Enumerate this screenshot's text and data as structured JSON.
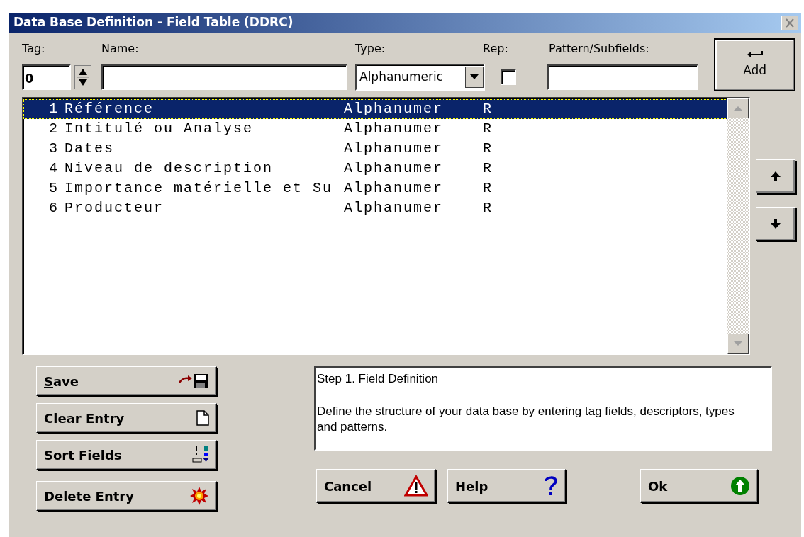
{
  "window": {
    "title": "Data Base Definition - Field Table (DDRC)"
  },
  "entry": {
    "tag": {
      "label": "Tag:",
      "value": "0"
    },
    "name": {
      "label": "Name:"
    },
    "type": {
      "label": "Type:",
      "value": "Alphanumeric"
    },
    "rep": {
      "label": "Rep:",
      "checked": false
    },
    "pattern": {
      "label": "Pattern/Subfields:"
    }
  },
  "add_button": {
    "label": "Add"
  },
  "fields": [
    {
      "number": "1",
      "name": "Référence",
      "type": "Alphanumer",
      "rep": "R",
      "selected": true
    },
    {
      "number": "2",
      "name": "Intitulé ou Analyse",
      "type": "Alphanumer",
      "rep": "R",
      "selected": false
    },
    {
      "number": "3",
      "name": "Dates",
      "type": "Alphanumer",
      "rep": "R",
      "selected": false
    },
    {
      "number": "4",
      "name": "Niveau de description",
      "type": "Alphanumer",
      "rep": "R",
      "selected": false
    },
    {
      "number": "5",
      "name": "Importance matérielle et Su",
      "type": "Alphanumer",
      "rep": "R",
      "selected": false
    },
    {
      "number": "6",
      "name": "Producteur",
      "type": "Alphanumer",
      "rep": "R",
      "selected": false
    }
  ],
  "actions": [
    {
      "label": "Save",
      "kind": "save",
      "underline_first": true
    },
    {
      "label": "Clear Entry",
      "kind": "clear",
      "underline_first": false
    },
    {
      "label": "Sort Fields",
      "kind": "sort",
      "underline_first": false
    },
    {
      "label": "Delete Entry",
      "kind": "delete",
      "underline_first": false
    }
  ],
  "info": {
    "title": "Step 1. Field Definition",
    "text": "Define the structure of your data base by entering tag fields, descriptors, types and patterns."
  },
  "dialog_buttons": [
    {
      "label": "Cancel",
      "kind": "cancel",
      "underline_first": true
    },
    {
      "label": "Help",
      "kind": "help",
      "underline_first": true
    },
    {
      "label": "Ok",
      "kind": "ok",
      "underline_first": true
    }
  ]
}
